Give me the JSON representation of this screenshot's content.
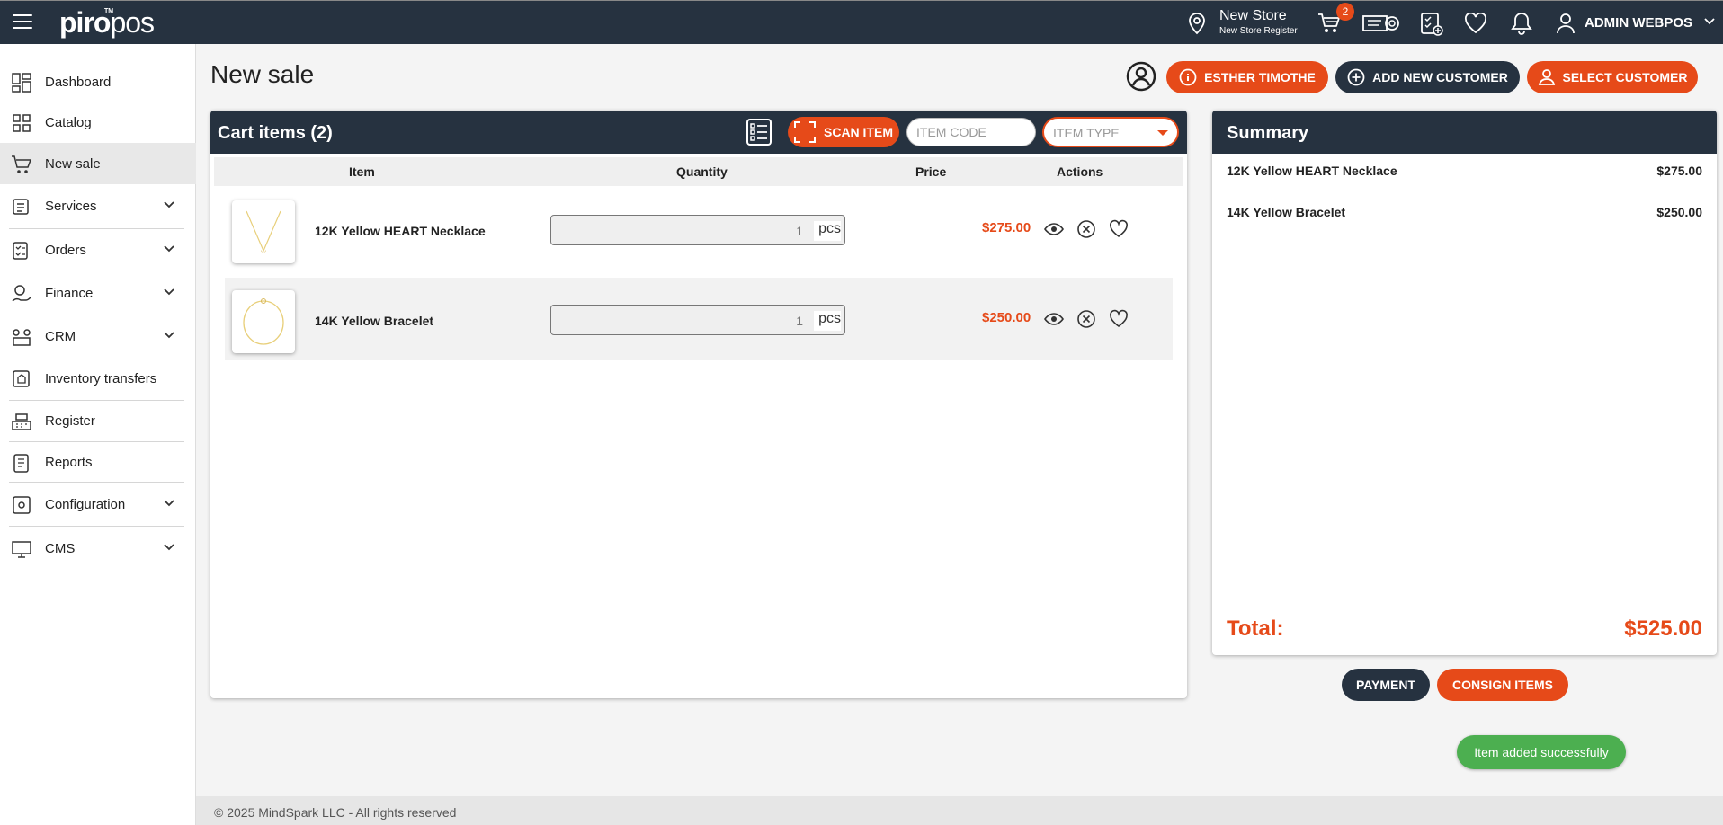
{
  "brand": {
    "logo_bold": "piro",
    "logo_light": "pos",
    "tm": "TM"
  },
  "topbar": {
    "store_name": "New Store",
    "store_register": "New Store Register",
    "cart_count": "2",
    "user": "ADMIN WEBPOS",
    "icons": [
      "menu-icon",
      "location-icon",
      "cart-icon",
      "ticket-icon",
      "checklist-icon",
      "heart-icon",
      "bell-icon",
      "user-icon",
      "chevron-down-icon"
    ]
  },
  "sidebar": {
    "items": [
      {
        "label": "Dashboard",
        "icon": "dashboard-icon",
        "expandable": false
      },
      {
        "label": "Catalog",
        "icon": "catalog-icon",
        "expandable": false
      },
      {
        "label": "New sale",
        "icon": "new-sale-icon",
        "expandable": false,
        "active": true
      },
      {
        "label": "Services",
        "icon": "services-icon",
        "expandable": true
      },
      {
        "label": "Orders",
        "icon": "orders-icon",
        "expandable": true
      },
      {
        "label": "Finance",
        "icon": "finance-icon",
        "expandable": true
      },
      {
        "label": "CRM",
        "icon": "crm-icon",
        "expandable": true
      },
      {
        "label": "Inventory transfers",
        "icon": "inventory-icon",
        "expandable": false
      },
      {
        "label": "Register",
        "icon": "register-icon",
        "expandable": false
      },
      {
        "label": "Reports",
        "icon": "reports-icon",
        "expandable": false
      },
      {
        "label": "Configuration",
        "icon": "configuration-icon",
        "expandable": true
      },
      {
        "label": "CMS",
        "icon": "cms-icon",
        "expandable": true
      }
    ]
  },
  "main": {
    "title": "New sale",
    "customer_button": "ESTHER TIMOTHE",
    "add_customer_button": "ADD NEW CUSTOMER",
    "select_customer_button": "SELECT CUSTOMER"
  },
  "cart": {
    "title": "Cart items (2)",
    "scan_label": "SCAN ITEM",
    "item_code_placeholder": "ITEM CODE",
    "item_type_placeholder": "ITEM TYPE",
    "columns": {
      "item": "Item",
      "quantity": "Quantity",
      "price": "Price",
      "actions": "Actions"
    },
    "rows": [
      {
        "name": "12K Yellow HEART Necklace",
        "qty": "1",
        "unit": "pcs",
        "price": "$275.00"
      },
      {
        "name": "14K Yellow Bracelet",
        "qty": "1",
        "unit": "pcs",
        "price": "$250.00"
      }
    ]
  },
  "summary": {
    "title": "Summary",
    "items": [
      {
        "name": "12K Yellow HEART Necklace",
        "price": "$275.00"
      },
      {
        "name": "14K Yellow Bracelet",
        "price": "$250.00"
      }
    ],
    "total_label": "Total:",
    "total_value": "$525.00"
  },
  "actions": {
    "payment": "PAYMENT",
    "consign": "CONSIGN ITEMS"
  },
  "toast": "Item added successfully",
  "footer": "© 2025 MindSpark LLC - All rights reserved",
  "colors": {
    "dark": "#263240",
    "accent": "#e64a19",
    "success": "#4caf50"
  }
}
